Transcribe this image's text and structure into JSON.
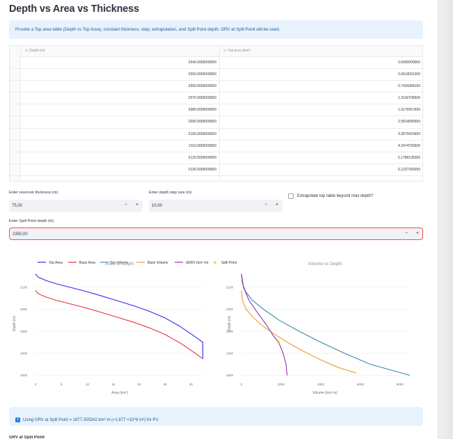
{
  "page": {
    "title": "Depth vs Area vs Thickness",
    "intro": "Provide a Top area table (Depth vs Top Area), constant thickness, step, extrapolation, and Spill Point depth. GRV at Spill Point will be used."
  },
  "table": {
    "columns": [
      "Depth (m)",
      "Top area (km²)"
    ],
    "rows": [
      [
        "2040.0000000000",
        "0.0000000000"
      ],
      [
        "2050.0000000000",
        "0.0614931300"
      ],
      [
        "2060.0000000000",
        "0.7434284150"
      ],
      [
        "2070.0000000000",
        "1.3142706500"
      ],
      [
        "2080.0000000000",
        "1.9176957650"
      ],
      [
        "2090.0000000000",
        "2.5814995550"
      ],
      [
        "2100.0000000000",
        "3.3570415650"
      ],
      [
        "2110.0000000000",
        "4.2474792600"
      ],
      [
        "2120.0000000000",
        "5.1786135350"
      ],
      [
        "2130.0000000000",
        "6.1227269250"
      ]
    ]
  },
  "inputs": {
    "thickness_label": "Enter reservoir thickness (m)",
    "thickness_value": "75,00",
    "step_label": "Enter depth step size (m)",
    "step_value": "10,00",
    "extrapolate_label": "Extrapolate top table beyond max depth?",
    "spill_label": "Enter Spill Point depth (m)",
    "spill_value": "2350,00",
    "minus": "−",
    "plus": "+"
  },
  "legend": {
    "top_area": "Top Area",
    "base_area": "Base Area",
    "top_volume": "Top Volume",
    "base_volume": "Base Volume",
    "dgrv": "dGRV (km²·m)",
    "spill": "Spill Point"
  },
  "colors": {
    "top_area": "#2b2bf0",
    "base_area": "#e8303c",
    "top_volume": "#3a88b0",
    "base_volume": "#f39a2c",
    "dgrv": "#8e35b0",
    "spill": "#f5c518",
    "accent": "#ff4b4b",
    "info_bg": "#e8f2fc",
    "info_text": "#1c5e9a"
  },
  "chart_data": [
    {
      "type": "line",
      "title": "Area vs Depth",
      "xlabel": "Area (km²)",
      "ylabel": "Depth (m)",
      "xticks": [
        "0",
        "5",
        "10",
        "15",
        "20",
        "25",
        "30"
      ],
      "yticks": [
        "2100",
        "2200",
        "2300",
        "2400",
        "2500"
      ],
      "xlim": [
        0,
        32.5
      ],
      "ylim": [
        2035,
        2505
      ],
      "y_reversed": true,
      "series": [
        {
          "name": "Top Area",
          "points": [
            [
              0,
              2040
            ],
            [
              0.5,
              2055
            ],
            [
              2,
              2070
            ],
            [
              4,
              2085
            ],
            [
              6.5,
              2100
            ],
            [
              9,
              2115
            ],
            [
              12,
              2135
            ],
            [
              15.5,
              2160
            ],
            [
              19,
              2185
            ],
            [
              22,
              2210
            ],
            [
              25,
              2240
            ],
            [
              28,
              2280
            ],
            [
              30.5,
              2320
            ],
            [
              32.3,
              2350
            ],
            [
              32.3,
              2425
            ]
          ]
        },
        {
          "name": "Base Area",
          "points": [
            [
              0,
              2115
            ],
            [
              0.5,
              2130
            ],
            [
              2,
              2145
            ],
            [
              4,
              2160
            ],
            [
              6.5,
              2175
            ],
            [
              9,
              2190
            ],
            [
              12,
              2210
            ],
            [
              15.5,
              2235
            ],
            [
              19,
              2260
            ],
            [
              22,
              2285
            ],
            [
              25,
              2315
            ],
            [
              28,
              2355
            ],
            [
              30.5,
              2395
            ],
            [
              32.3,
              2425
            ]
          ]
        }
      ]
    },
    {
      "type": "line",
      "title": "Volume vs Depth",
      "xlabel": "Volume (km²·m)",
      "ylabel": "Depth (m)",
      "xticks": [
        "0",
        "2000",
        "4000",
        "6000",
        "8000"
      ],
      "xlim": [
        0,
        8500
      ],
      "ylim": [
        2035,
        2505
      ],
      "y_reversed": true,
      "series": [
        {
          "name": "Top Volume",
          "points": [
            [
              0,
              2040
            ],
            [
              40,
              2080
            ],
            [
              200,
              2120
            ],
            [
              550,
              2160
            ],
            [
              1100,
              2200
            ],
            [
              1900,
              2250
            ],
            [
              2900,
              2300
            ],
            [
              4000,
              2350
            ],
            [
              5200,
              2400
            ],
            [
              6500,
              2450
            ],
            [
              8500,
              2500
            ]
          ]
        },
        {
          "name": "Base Volume",
          "points": [
            [
              0,
              2115
            ],
            [
              40,
              2155
            ],
            [
              200,
              2195
            ],
            [
              550,
              2235
            ],
            [
              1050,
              2275
            ],
            [
              1600,
              2310
            ],
            [
              2300,
              2350
            ],
            [
              3100,
              2390
            ],
            [
              4000,
              2430
            ],
            [
              4900,
              2465
            ],
            [
              5800,
              2490
            ]
          ]
        },
        {
          "name": "dGRV (km²·m)",
          "points": [
            [
              0,
              2040
            ],
            [
              100,
              2100
            ],
            [
              380,
              2160
            ],
            [
              800,
              2215
            ],
            [
              1250,
              2270
            ],
            [
              1600,
              2320
            ],
            [
              1877,
              2350
            ],
            [
              2100,
              2400
            ],
            [
              2250,
              2450
            ],
            [
              2300,
              2500
            ]
          ]
        }
      ],
      "spill_point": {
        "name": "Spill Point",
        "x": 1877.355,
        "y": 2350
      }
    }
  ],
  "result": {
    "icon": "i",
    "text": "Using GRV at Spill Point = 1877.355342 km²·m (≈1,877 ×10^6 m³) for PV.",
    "next_heading": "GRV at Spill Point"
  }
}
